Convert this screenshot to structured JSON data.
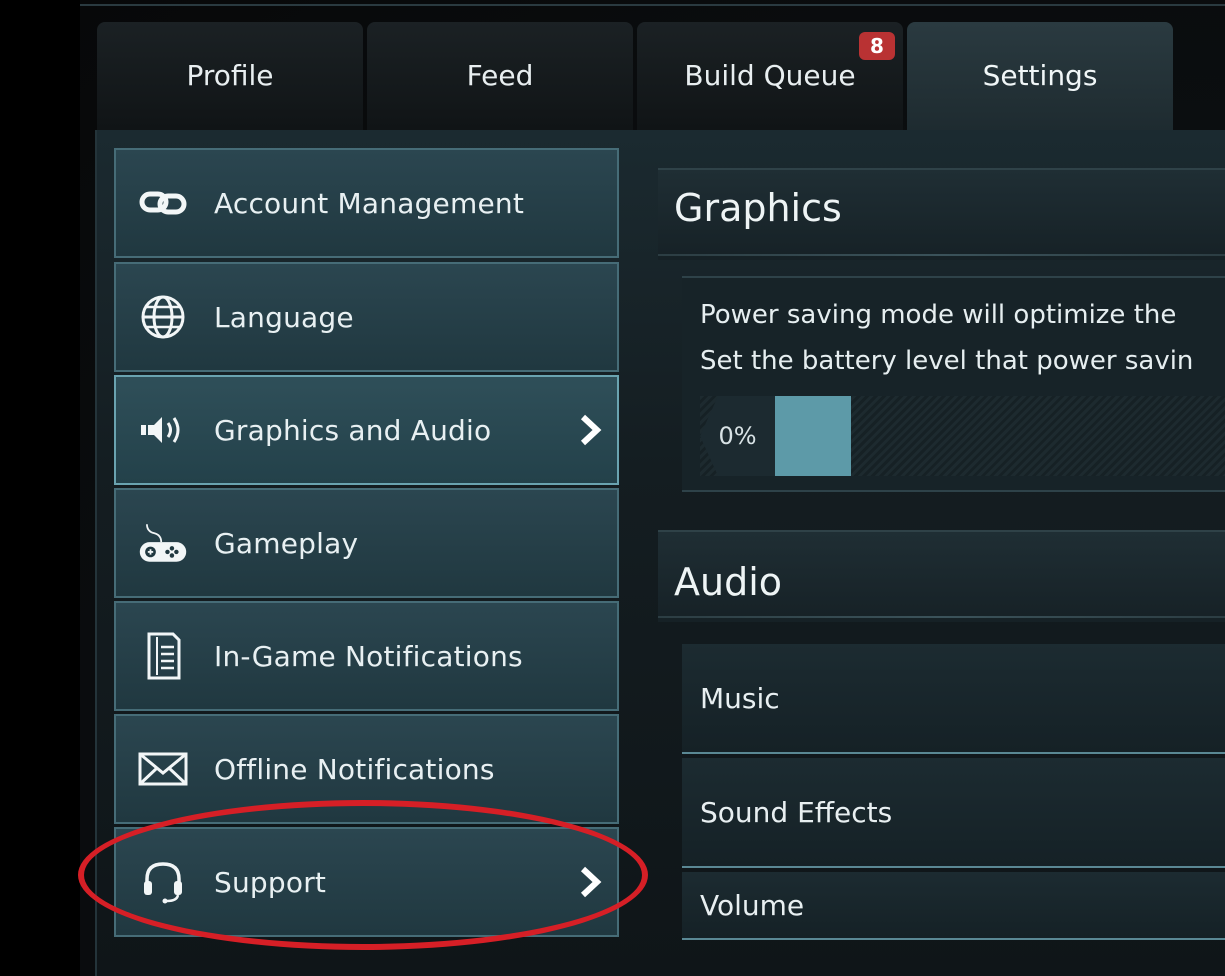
{
  "tabs": [
    {
      "label": "Profile"
    },
    {
      "label": "Feed"
    },
    {
      "label": "Build Queue",
      "badge": "8"
    },
    {
      "label": "Settings",
      "active": true
    }
  ],
  "sidebar": {
    "items": [
      {
        "label": "Account Management",
        "icon": "link-icon"
      },
      {
        "label": "Language",
        "icon": "globe-icon"
      },
      {
        "label": "Graphics and Audio",
        "icon": "speaker-icon",
        "selected": true
      },
      {
        "label": "Gameplay",
        "icon": "gamepad-icon"
      },
      {
        "label": "In-Game Notifications",
        "icon": "document-icon"
      },
      {
        "label": "Offline Notifications",
        "icon": "envelope-icon"
      },
      {
        "label": "Support",
        "icon": "headset-icon",
        "highlighted": true
      }
    ]
  },
  "graphics": {
    "title": "Graphics",
    "line1": "Power saving mode will optimize the",
    "line2": "Set the battery level that power savin",
    "slider_value": "0%"
  },
  "audio": {
    "title": "Audio",
    "rows": [
      {
        "label": "Music"
      },
      {
        "label": "Sound Effects"
      },
      {
        "label": "Volume"
      }
    ]
  },
  "colors": {
    "accent": "#5d9aa8",
    "badge": "#b93233",
    "highlight_circle": "#d61f26"
  }
}
